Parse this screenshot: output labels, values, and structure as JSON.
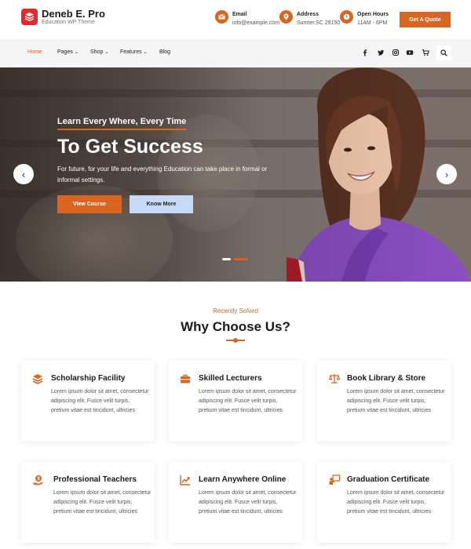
{
  "header": {
    "brand_title": "Deneb E. Pro",
    "brand_tagline": "Education WP Theme",
    "email_label": "Email",
    "email_value": "info@example.com",
    "address_label": "Address",
    "address_value": "Sumter,SC 29150",
    "hours_label": "Open Hours",
    "hours_value": "11AM - 6PM",
    "quote_button": "Get A Quote"
  },
  "nav": {
    "items": [
      {
        "label": "Home",
        "active": true
      },
      {
        "label": "Pages"
      },
      {
        "label": "Shop"
      },
      {
        "label": "Features"
      },
      {
        "label": "Blog"
      }
    ],
    "icons": [
      "facebook-icon",
      "twitter-icon",
      "instagram-icon",
      "youtube-icon",
      "cart-icon",
      "search-icon"
    ]
  },
  "hero": {
    "subtitle": "Learn Every Where, Every Time",
    "title": "To Get Success",
    "description": "For future, for your life and everything Education can take place in formal or informal settings.",
    "primary_button": "View Course",
    "secondary_button": "Know More",
    "prev_arrow": "‹",
    "next_arrow": "›"
  },
  "why": {
    "eyebrow": "Recently Solved",
    "title": "Why Choose Us?",
    "cards": [
      {
        "title": "Scholarship Facility",
        "icon": "layers-icon",
        "text": "Lorem ipsum dolor sit amet, consectetur adipiscing elit. Fusce velit turpis, pretium vitae est tincidunt, ultricies"
      },
      {
        "title": "Skilled Lecturers",
        "icon": "briefcase-icon",
        "text": "Lorem ipsum dolor sit amet, consectetur adipiscing elit. Fusce velit turpis, pretium vitae est tincidunt, ultricies"
      },
      {
        "title": "Book Library & Store",
        "icon": "balance-scale-icon",
        "text": "Lorem ipsum dolor sit amet, consectetur adipiscing elit. Fusce velit turpis, pretium vitae est tincidunt, ultricies"
      },
      {
        "title": "Professional Teachers",
        "icon": "money-hand-icon",
        "text": "Lorem ipsum dolor sit amet, consectetur adipiscing elit. Fusce velit turpis, pretium vitae est tincidunt, ultricies"
      },
      {
        "title": "Learn Anywhere Online",
        "icon": "chart-line-icon",
        "text": "Lorem ipsum dolor sit amet, consectetur adipiscing elit. Fusce velit turpis, pretium vitae est tincidunt, ultricies"
      },
      {
        "title": "Graduation Certificate",
        "icon": "teacher-board-icon",
        "text": "Lorem ipsum dolor sit amet, consectetur adipiscing elit. Fusce velit turpis, pretium vitae est tincidunt, ultricies"
      }
    ]
  },
  "colors": {
    "accent": "#d96520",
    "logo": "#e8262b",
    "secondary_button": "#c5daf6"
  }
}
